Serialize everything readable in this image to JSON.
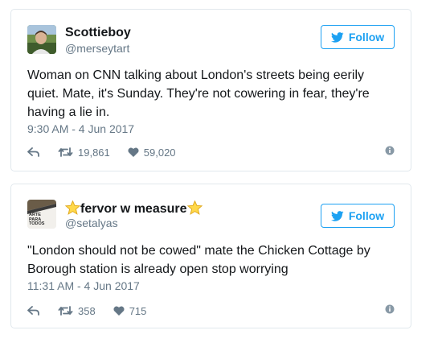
{
  "tweets": [
    {
      "display_name": "Scottieboy",
      "handle": "@merseytart",
      "follow_label": "Follow",
      "text": "Woman on CNN talking about London's streets being eerily quiet. Mate, it's Sunday. They're not cowering in fear, they're having a lie in.",
      "timestamp": "9:30 AM - 4 Jun 2017",
      "retweets": "19,861",
      "likes": "59,020"
    },
    {
      "display_name": "fervor w measure",
      "handle": "@setalyas",
      "follow_label": "Follow",
      "avatar_text": "ARTE PARA TODOS",
      "text": "\"London should not be cowed\" mate the Chicken Cottage by Borough station is already open stop worrying",
      "timestamp": "11:31 AM - 4 Jun 2017",
      "retweets": "358",
      "likes": "715"
    }
  ],
  "colors": {
    "accent": "#1da1f2",
    "muted": "#657786",
    "border": "#e1e8ed",
    "text": "#14171a"
  },
  "icons": [
    "twitter-bird-icon",
    "reply-icon",
    "retweet-icon",
    "heart-icon",
    "info-icon",
    "star-icon"
  ]
}
